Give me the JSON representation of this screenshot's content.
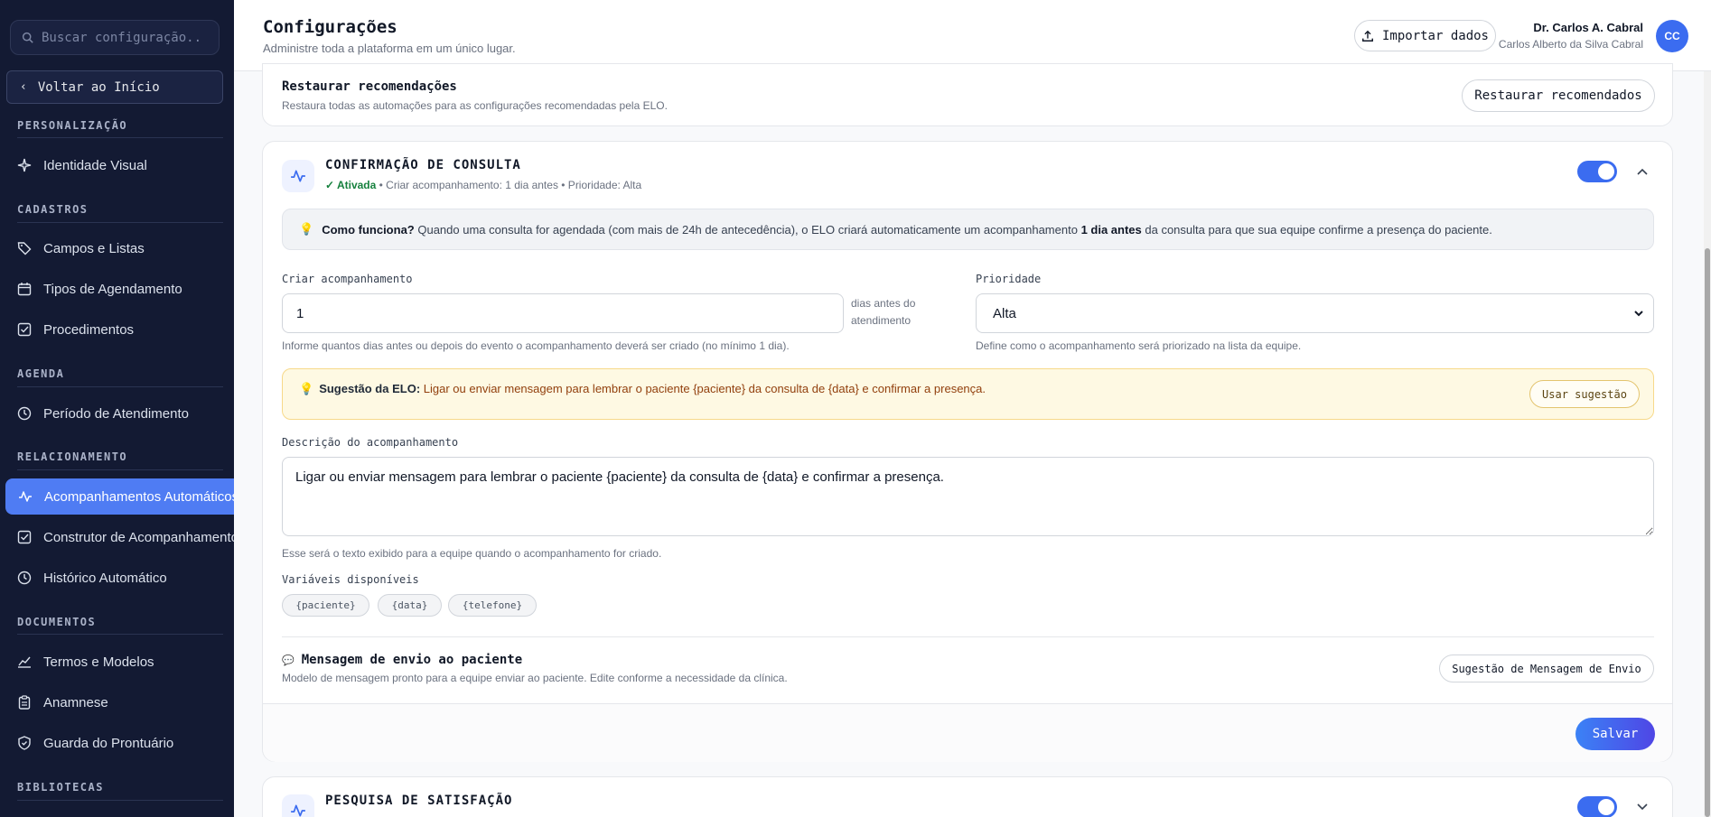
{
  "sidebar": {
    "search_placeholder": "Buscar configuração...",
    "back_label": "Voltar ao Início",
    "sections": {
      "personalizacao": "PERSONALIZAÇÃO",
      "cadastros": "CADASTROS",
      "agenda": "AGENDA",
      "relacionamento": "RELACIONAMENTO",
      "documentos": "DOCUMENTOS",
      "bibliotecas": "BIBLIOTECAS"
    },
    "items": {
      "identidade": "Identidade Visual",
      "campos": "Campos e Listas",
      "tipos": "Tipos de Agendamento",
      "procedimentos": "Procedimentos",
      "periodo": "Período de Atendimento",
      "acompanhamentos": "Acompanhamentos Automáticos",
      "construtor": "Construtor de Acompanhamentos",
      "historico": "Histórico Automático",
      "termos": "Termos e Modelos",
      "anamnese": "Anamnese",
      "guarda": "Guarda do Prontuário"
    }
  },
  "header": {
    "title": "Configurações",
    "subtitle": "Administre toda a plataforma em um único lugar.",
    "import_label": "Importar dados",
    "user_name": "Dr. Carlos A. Cabral",
    "user_full_name": "Carlos Alberto da Silva Cabral",
    "avatar_initials": "CC"
  },
  "restore": {
    "title": "Restaurar recomendações",
    "description": "Restaura todas as automações para as configurações recomendadas pela ELO.",
    "button": "Restaurar recomendados"
  },
  "confirmation": {
    "title": "CONFIRMAÇÃO DE CONSULTA",
    "status": "✓ Ativada",
    "meta": " • Criar acompanhamento: 1 dia antes • Prioridade: Alta",
    "enabled": true,
    "info_label": "Como funciona?",
    "info_text_1": " Quando uma consulta for agendada (com mais de 24h de antecedência), o ELO criará automaticamente um acompanhamento ",
    "info_bold": "1 dia antes",
    "info_text_2": " da consulta para que sua equipe confirme a presença do paciente.",
    "create_label": "Criar acompanhamento",
    "create_value": "1",
    "create_suffix": "dias antes do atendimento",
    "create_help": "Informe quantos dias antes ou depois do evento o acompanhamento deverá ser criado (no mínimo 1 dia).",
    "priority_label": "Prioridade",
    "priority_value": "Alta",
    "priority_help": "Define como o acompanhamento será priorizado na lista da equipe.",
    "suggestion_label": "Sugestão da ELO:",
    "suggestion_text": " Ligar ou enviar mensagem para lembrar o paciente {paciente} da consulta de {data} e confirmar a presença.",
    "suggestion_button": "Usar sugestão",
    "description_label": "Descrição do acompanhamento",
    "description_value": "Ligar ou enviar mensagem para lembrar o paciente {paciente} da consulta de {data} e confirmar a presença.",
    "description_help": "Esse será o texto exibido para a equipe quando o acompanhamento for criado.",
    "variables_label": "Variáveis disponíveis",
    "variables": [
      "{paciente}",
      "{data}",
      "{telefone}"
    ],
    "message_title": "Mensagem de envio ao paciente",
    "message_desc": "Modelo de mensagem pronto para a equipe enviar ao paciente. Edite conforme a necessidade da clínica.",
    "message_button": "Sugestão de Mensagem de Envio",
    "save_button": "Salvar"
  },
  "satisfaction": {
    "title": "PESQUISA DE SATISFAÇÃO",
    "enabled": true
  },
  "colors": {
    "sidebar_bg": "#131a33",
    "accent": "#3b6cf0",
    "active_nav": "#4f7cf3",
    "success": "#15803d",
    "suggestion_bg": "#fef9e3"
  }
}
